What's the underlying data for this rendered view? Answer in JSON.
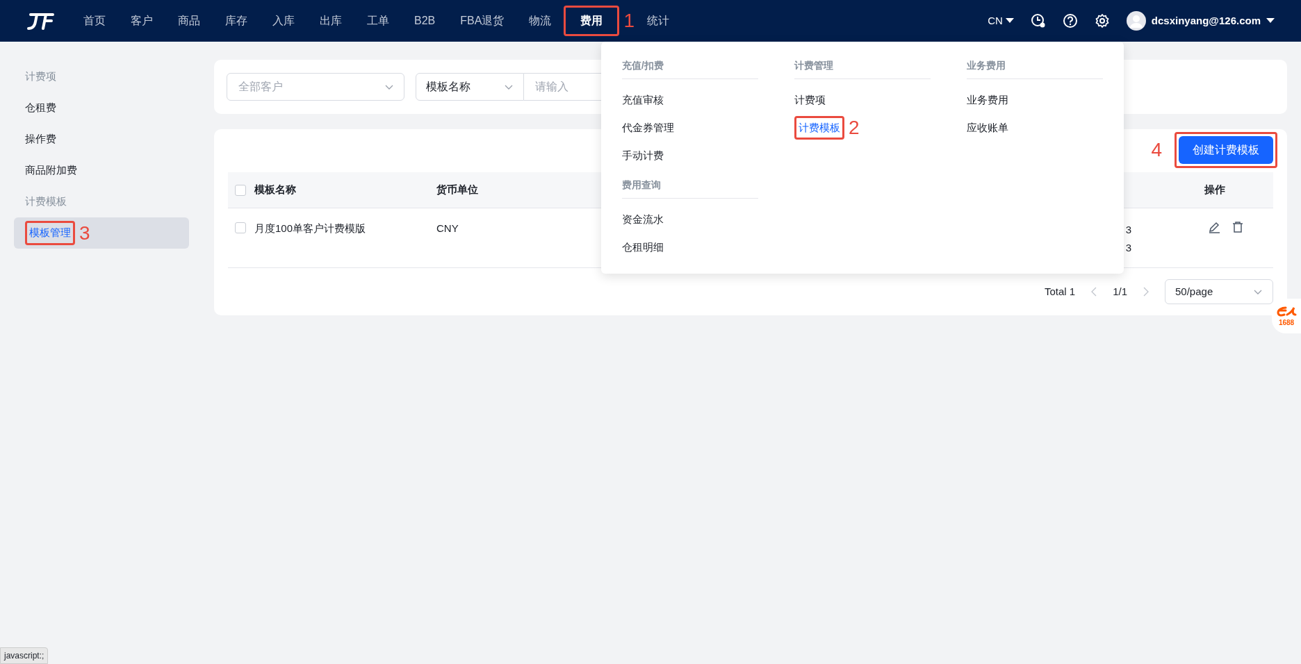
{
  "navbar": {
    "items": [
      {
        "label": "首页",
        "selected": false
      },
      {
        "label": "客户",
        "selected": false
      },
      {
        "label": "商品",
        "selected": false
      },
      {
        "label": "库存",
        "selected": false
      },
      {
        "label": "入库",
        "selected": false
      },
      {
        "label": "出库",
        "selected": false
      },
      {
        "label": "工单",
        "selected": false
      },
      {
        "label": "B2B",
        "selected": false
      },
      {
        "label": "FBA退货",
        "selected": false
      },
      {
        "label": "物流",
        "selected": false
      },
      {
        "label": "费用",
        "selected": true,
        "callout": "1"
      },
      {
        "label": "统计",
        "selected": false
      }
    ],
    "language": "CN",
    "user": "dcsxinyang@126.com"
  },
  "dropdown_menu": {
    "columns": [
      {
        "groups": [
          {
            "heading": "充值/扣费",
            "items": [
              {
                "label": "充值审核",
                "selected": false
              },
              {
                "label": "代金券管理",
                "selected": false
              },
              {
                "label": "手动计费",
                "selected": false
              }
            ]
          },
          {
            "heading": "费用查询",
            "items": [
              {
                "label": "资金流水",
                "selected": false
              },
              {
                "label": "仓租明细",
                "selected": false
              }
            ]
          }
        ]
      },
      {
        "groups": [
          {
            "heading": "计费管理",
            "items": [
              {
                "label": "计费项",
                "selected": false
              },
              {
                "label": "计费模板",
                "selected": true,
                "callout": "2"
              }
            ]
          }
        ]
      },
      {
        "groups": [
          {
            "heading": "业务费用",
            "items": [
              {
                "label": "业务费用",
                "selected": false
              },
              {
                "label": "应收账单",
                "selected": false
              }
            ]
          }
        ]
      }
    ]
  },
  "sidebar": {
    "items": [
      {
        "kind": "heading",
        "label": "计费项"
      },
      {
        "kind": "link",
        "label": "仓租费",
        "selected": false
      },
      {
        "kind": "link",
        "label": "操作费",
        "selected": false
      },
      {
        "kind": "link",
        "label": "商品附加费",
        "selected": false
      },
      {
        "kind": "heading",
        "label": "计费模板"
      },
      {
        "kind": "link",
        "label": "模板管理",
        "selected": true,
        "callout": "3"
      }
    ]
  },
  "filters": {
    "customer": {
      "placeholder": "全部客户"
    },
    "field_select": "模板名称",
    "search": {
      "placeholder": "请输入"
    }
  },
  "create_button": {
    "label": "创建计费模板",
    "callout": "4"
  },
  "table": {
    "columns": [
      "模板名称",
      "货币单位",
      "操作"
    ],
    "rows": [
      {
        "checked": false,
        "template_name": "月度100单客户计费模版",
        "currency": "CNY",
        "column_3": [
          "3",
          "3"
        ]
      }
    ],
    "header_checked": false
  },
  "pagination": {
    "total": "Total 1",
    "page": "1/1",
    "page_size": "50/page"
  },
  "floating_badge": "1688",
  "status_bar": "javascript:;"
}
